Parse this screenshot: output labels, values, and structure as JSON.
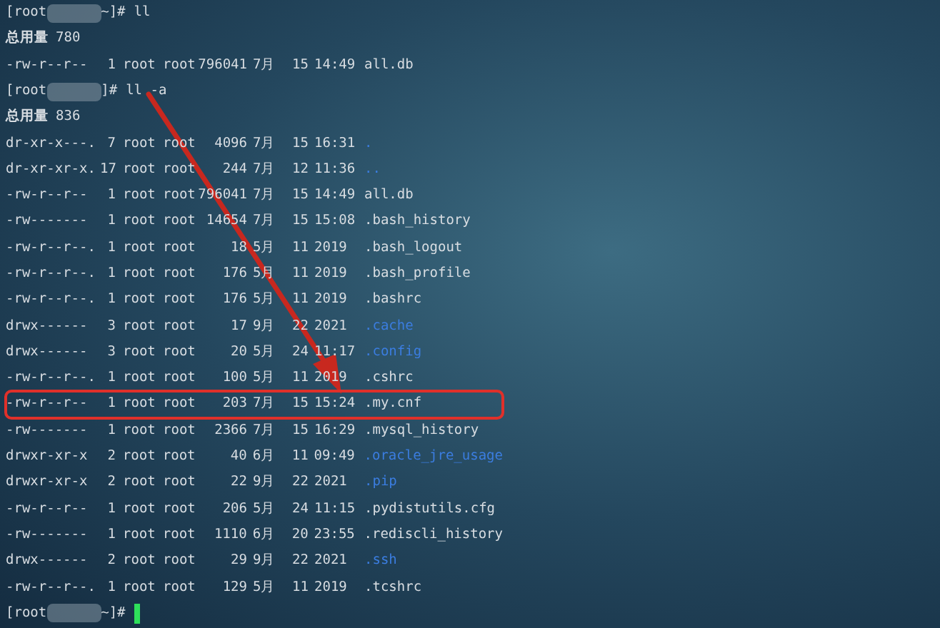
{
  "blocks": [
    {
      "prompt": {
        "prefix": "[root",
        "suffix": "~]#",
        "command": "ll"
      },
      "total": {
        "label": "总用量",
        "value": "780"
      },
      "rows": [
        {
          "perms": "-rw-r--r--",
          "links": "1",
          "owner": "root",
          "group": "root",
          "size": "796041",
          "month": "7月",
          "day": "15",
          "time": "14:49",
          "name": "all.db",
          "kind": "file",
          "highlighted": false
        }
      ]
    },
    {
      "prompt": {
        "prefix": "[root",
        "suffix": "]#",
        "command": "ll -a"
      },
      "total": {
        "label": "总用量",
        "value": "836"
      },
      "rows": [
        {
          "perms": "dr-xr-x---.",
          "links": "7",
          "owner": "root",
          "group": "root",
          "size": "4096",
          "month": "7月",
          "day": "15",
          "time": "16:31",
          "name": ".",
          "kind": "dir",
          "highlighted": false
        },
        {
          "perms": "dr-xr-xr-x.",
          "links": "17",
          "owner": "root",
          "group": "root",
          "size": "244",
          "month": "7月",
          "day": "12",
          "time": "11:36",
          "name": "..",
          "kind": "dir",
          "highlighted": false
        },
        {
          "perms": "-rw-r--r--",
          "links": "1",
          "owner": "root",
          "group": "root",
          "size": "796041",
          "month": "7月",
          "day": "15",
          "time": "14:49",
          "name": "all.db",
          "kind": "file",
          "highlighted": false
        },
        {
          "perms": "-rw-------",
          "links": "1",
          "owner": "root",
          "group": "root",
          "size": "14654",
          "month": "7月",
          "day": "15",
          "time": "15:08",
          "name": ".bash_history",
          "kind": "file",
          "highlighted": false
        },
        {
          "perms": "-rw-r--r--.",
          "links": "1",
          "owner": "root",
          "group": "root",
          "size": "18",
          "month": "5月",
          "day": "11",
          "time": "2019",
          "name": ".bash_logout",
          "kind": "file",
          "highlighted": false
        },
        {
          "perms": "-rw-r--r--.",
          "links": "1",
          "owner": "root",
          "group": "root",
          "size": "176",
          "month": "5月",
          "day": "11",
          "time": "2019",
          "name": ".bash_profile",
          "kind": "file",
          "highlighted": false
        },
        {
          "perms": "-rw-r--r--.",
          "links": "1",
          "owner": "root",
          "group": "root",
          "size": "176",
          "month": "5月",
          "day": "11",
          "time": "2019",
          "name": ".bashrc",
          "kind": "file",
          "highlighted": false
        },
        {
          "perms": "drwx------",
          "links": "3",
          "owner": "root",
          "group": "root",
          "size": "17",
          "month": "9月",
          "day": "22",
          "time": "2021",
          "name": ".cache",
          "kind": "dir",
          "highlighted": false
        },
        {
          "perms": "drwx------",
          "links": "3",
          "owner": "root",
          "group": "root",
          "size": "20",
          "month": "5月",
          "day": "24",
          "time": "11:17",
          "name": ".config",
          "kind": "dir",
          "highlighted": false
        },
        {
          "perms": "-rw-r--r--.",
          "links": "1",
          "owner": "root",
          "group": "root",
          "size": "100",
          "month": "5月",
          "day": "11",
          "time": "2019",
          "name": ".cshrc",
          "kind": "file",
          "highlighted": false
        },
        {
          "perms": "-rw-r--r--",
          "links": "1",
          "owner": "root",
          "group": "root",
          "size": "203",
          "month": "7月",
          "day": "15",
          "time": "15:24",
          "name": ".my.cnf",
          "kind": "file",
          "highlighted": true
        },
        {
          "perms": "-rw-------",
          "links": "1",
          "owner": "root",
          "group": "root",
          "size": "2366",
          "month": "7月",
          "day": "15",
          "time": "16:29",
          "name": ".mysql_history",
          "kind": "file",
          "highlighted": false
        },
        {
          "perms": "drwxr-xr-x",
          "links": "2",
          "owner": "root",
          "group": "root",
          "size": "40",
          "month": "6月",
          "day": "11",
          "time": "09:49",
          "name": ".oracle_jre_usage",
          "kind": "dir",
          "highlighted": false
        },
        {
          "perms": "drwxr-xr-x",
          "links": "2",
          "owner": "root",
          "group": "root",
          "size": "22",
          "month": "9月",
          "day": "22",
          "time": "2021",
          "name": ".pip",
          "kind": "dir",
          "highlighted": false
        },
        {
          "perms": "-rw-r--r--",
          "links": "1",
          "owner": "root",
          "group": "root",
          "size": "206",
          "month": "5月",
          "day": "24",
          "time": "11:15",
          "name": ".pydistutils.cfg",
          "kind": "file",
          "highlighted": false
        },
        {
          "perms": "-rw-------",
          "links": "1",
          "owner": "root",
          "group": "root",
          "size": "1110",
          "month": "6月",
          "day": "20",
          "time": "23:55",
          "name": ".rediscli_history",
          "kind": "file",
          "highlighted": false
        },
        {
          "perms": "drwx------",
          "links": "2",
          "owner": "root",
          "group": "root",
          "size": "29",
          "month": "9月",
          "day": "22",
          "time": "2021",
          "name": ".ssh",
          "kind": "dir",
          "highlighted": false
        },
        {
          "perms": "-rw-r--r--.",
          "links": "1",
          "owner": "root",
          "group": "root",
          "size": "129",
          "month": "5月",
          "day": "11",
          "time": "2019",
          "name": ".tcshrc",
          "kind": "file",
          "highlighted": false
        }
      ]
    }
  ],
  "final_prompt": {
    "prefix": "[root",
    "suffix": "~]#",
    "cursor": true
  }
}
